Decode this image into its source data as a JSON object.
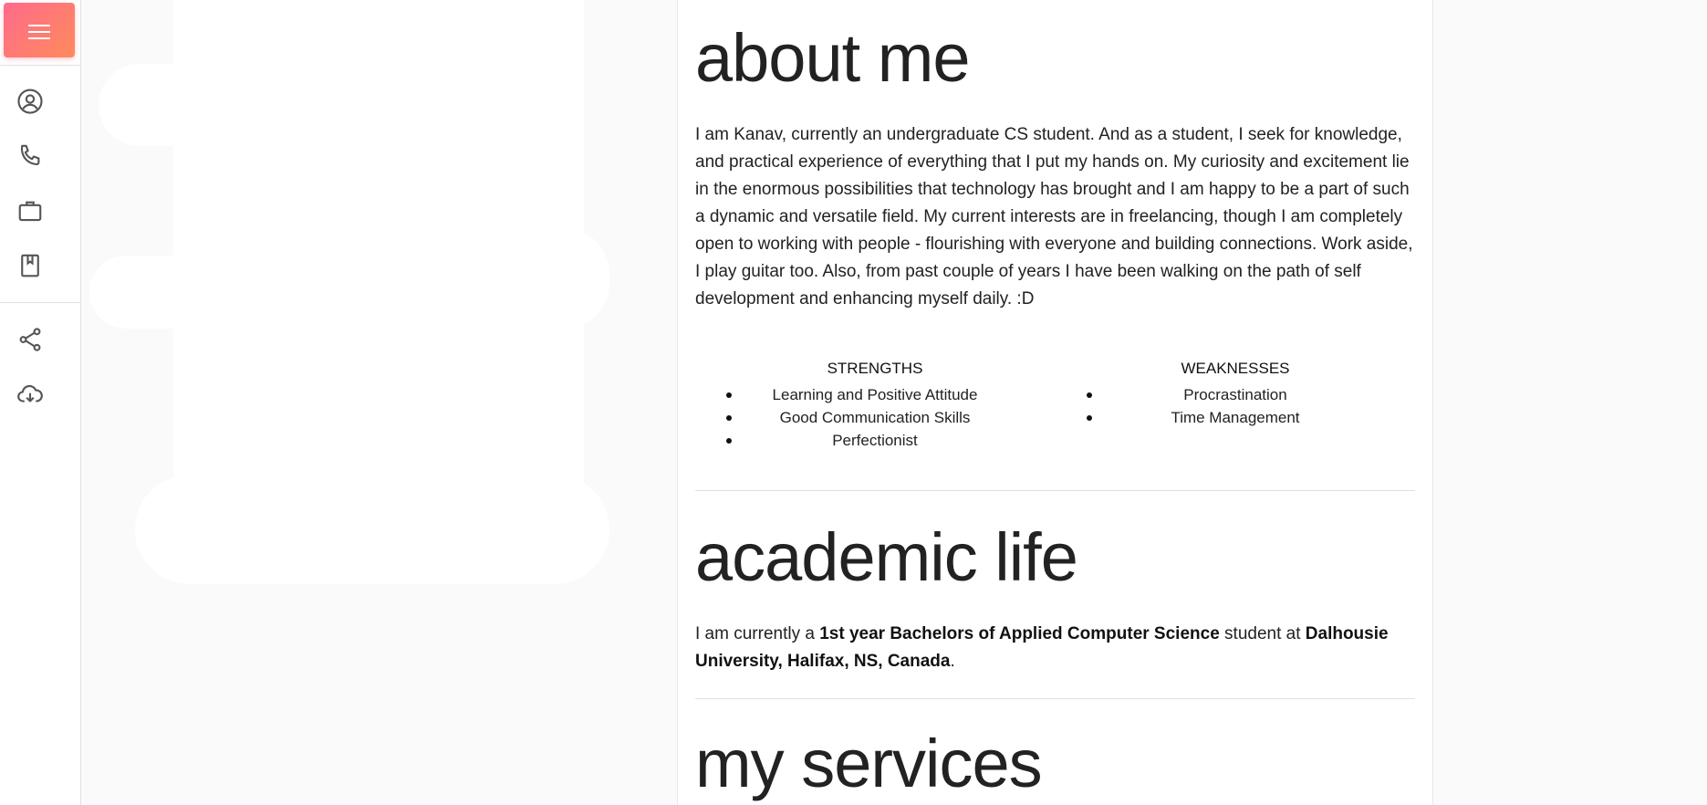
{
  "sidebar": {
    "menu_icon": "hamburger-menu-icon",
    "nav_items": [
      {
        "icon": "user-circle-icon",
        "label": "About"
      },
      {
        "icon": "phone-icon",
        "label": "Contact"
      },
      {
        "icon": "briefcase-icon",
        "label": "Work"
      },
      {
        "icon": "bookmark-book-icon",
        "label": "Blog"
      }
    ],
    "action_items": [
      {
        "icon": "share-icon"
      },
      {
        "icon": "cloud-download-icon"
      }
    ],
    "accent_gradient": [
      "#ff6b8b",
      "#ff8a5c"
    ]
  },
  "about": {
    "title": "about me",
    "text": "I am Kanav, currently an undergraduate CS student. And as a student, I seek for knowledge, and practical experience of everything that I put my hands on. My curiosity and excitement lie in the enormous possibilities that technology has brought and I am happy to be a part of such a dynamic and versatile field. My current interests are in freelancing, though I am completely open to working with people - flourishing with everyone and building connections. Work aside, I play guitar too. Also, from past couple of years I have been walking on the path of self development and enhancing myself daily. :D",
    "strengths": {
      "heading": "STRENGTHS",
      "items": [
        "Learning and Positive Attitude",
        "Good Communication Skills",
        "Perfectionist"
      ]
    },
    "weaknesses": {
      "heading": "WEAKNESSES",
      "items": [
        "Procrastination",
        "Time Management"
      ]
    }
  },
  "academic": {
    "title": "academic life",
    "text_prefix": "I am currently a ",
    "degree": "1st year Bachelors of Applied Computer Science",
    "text_middle": " student at ",
    "university": "Dalhousie University, Halifax, NS, Canada",
    "text_suffix": "."
  },
  "services": {
    "title": "my services"
  }
}
